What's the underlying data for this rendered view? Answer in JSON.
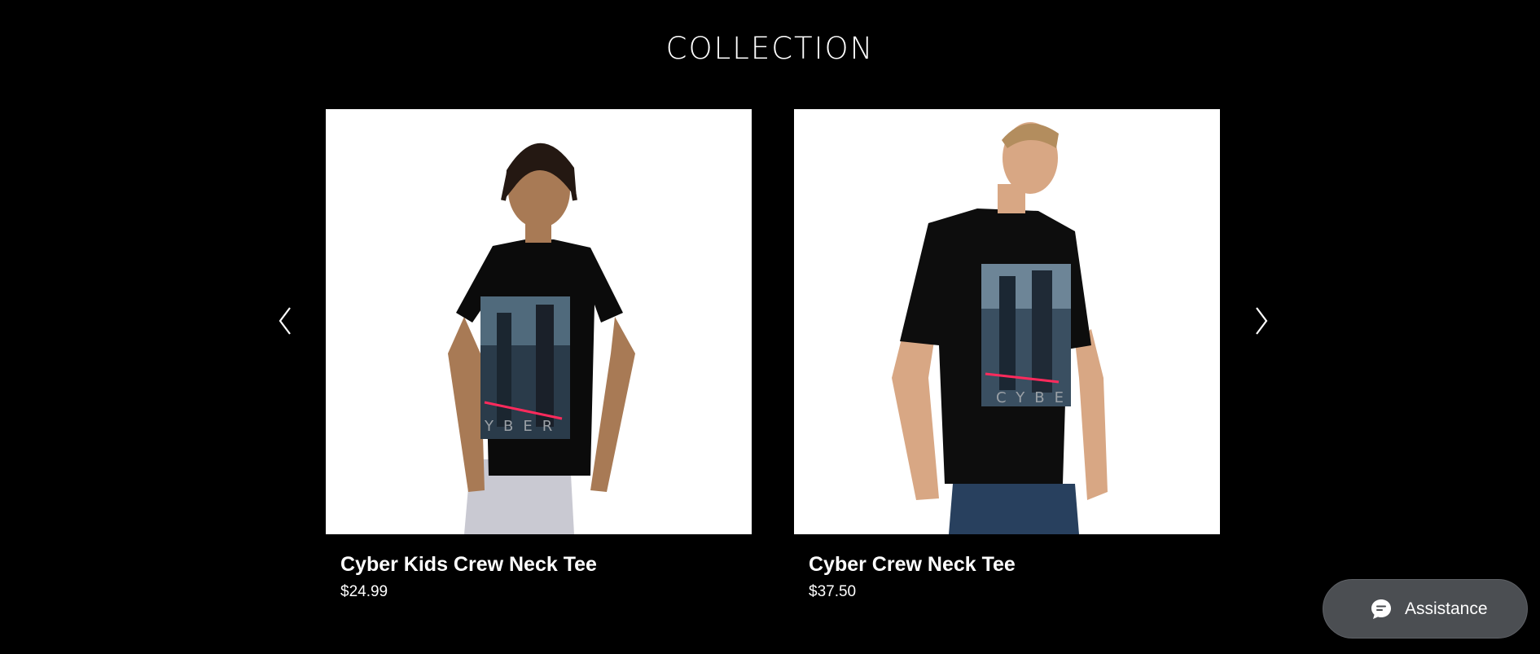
{
  "section": {
    "title": "COLLECTION"
  },
  "carousel": {
    "prev_icon": "chevron-left-icon",
    "next_icon": "chevron-right-icon",
    "products": [
      {
        "name": "Cyber Kids Crew Neck Tee",
        "price": "$24.99",
        "image_desc": "child-wearing-black-cyber-tee"
      },
      {
        "name": "Cyber Crew Neck Tee",
        "price": "$37.50",
        "image_desc": "man-wearing-black-cyber-tee"
      }
    ]
  },
  "assistance": {
    "label": "Assistance",
    "icon": "chat-bubble-icon"
  },
  "colors": {
    "background": "#000000",
    "text": "#ffffff",
    "assist_bg": "#4b4e52",
    "card_bg": "#ffffff"
  }
}
